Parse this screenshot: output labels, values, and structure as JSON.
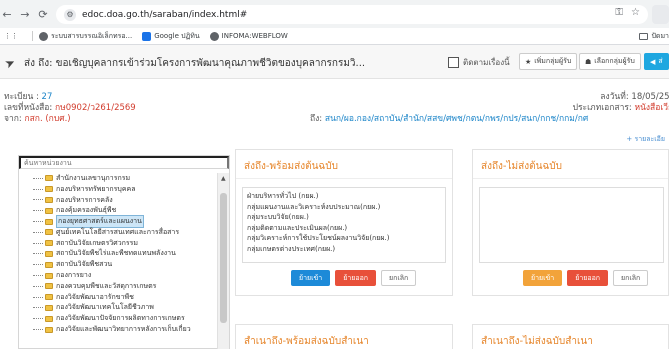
{
  "browser": {
    "url": "edoc.doa.go.th/saraban/index.html#",
    "bookmarks": [
      "ระบบสารบรรณอิเล็กทรอ...",
      "Google ปฏิทิน",
      "INFOMA:WEBFLOW"
    ],
    "bookmarks_right": "ปัดมา"
  },
  "header": {
    "title": "ส่ง ถึง: ขอเชิญบุคลากรเข้าร่วมโครงการพัฒนาคุณภาพชีวิตของบุคลากรกรมวิ...",
    "follow_label": "ติดตามเรื่องนี้",
    "add_group_label": "เพิ่มกลุ่มผู้รับ",
    "select_group_label": "เลือกกลุ่มผู้รับ",
    "send_label": "ส่"
  },
  "meta": {
    "reg_label": "ทะเบียน :",
    "reg_value": "27",
    "doc_no_label": "เลขที่หนังสือ",
    "doc_no_value": "กษ0902/ว261/2569",
    "from_label": "จาก:",
    "from_value": "กสก. (กบศ.)",
    "to_label": "ถึง:",
    "to_value": "สนก/ผอ.กอง/สถาบัน/สำนัก/สสข/ศพช/กตน/กพร/กปร/สนก/กกช/กกม/กศ",
    "date_label": "ลงวันที่:",
    "date_value": "18/05/256",
    "type_label": "ประเภทเอกสาร:",
    "type_value": "หนังสือเวีย",
    "more_link": "+ รายละเอีย"
  },
  "tree": {
    "search_placeholder": "ค้นหาหน่วยงาน",
    "items": [
      "สำนักงานเลขานุการกรม",
      "กองบริหารทรัพยากรบุคคล",
      "กองบริหารการคลัง",
      "กองคุ้มครองพันธุ์พืช",
      "กองยุทธศาสตร์และแผนงาน",
      "ศูนย์เทคโนโลยีสารสนเทศและการสื่อสาร",
      "สถาบันวิจัยเกษตรวิศวกรรม",
      "สถาบันวิจัยพืชไร่และพืชทดแทนพลังงาน",
      "สถาบันวิจัยพืชสวน",
      "กองการยาง",
      "กองควบคุมพืชและวัสดุการเกษตร",
      "กองวิจัยพัฒนาอารักขาพืช",
      "กองวิจัยพัฒนาเทคโนโลยีชีวภาพ",
      "กองวิจัยพัฒนาปัจจัยการผลิตทางการเกษตร",
      "กองวิจัยและพัฒนาวิทยาการหลังการเก็บเกี่ยว"
    ],
    "selected_index": 4
  },
  "cards": {
    "send_with_original": {
      "title": "ส่งถึง-พร้อมส่งต้นฉบับ",
      "rows": [
        "ฝ่ายบริหารทั่วไป (กยผ.)",
        "กลุ่มแผนงานและวิเคราะห์งบประมาณ(กยผ.)",
        "กลุ่มระบบวิจัย(กยผ.)",
        "กลุ่มติดตามและประเมินผล(กยผ.)",
        "กลุ่มวิเคราะห์การใช้ประโยชน์ผลงานวิจัย(กยผ.)",
        "กลุ่มเกษตรต่างประเทศ(กยผ.)"
      ],
      "btn_move_in": "ย้ายเข้า",
      "btn_move_out": "ย้ายออก",
      "btn_cancel": "ยกเลิก"
    },
    "send_without_original": {
      "title": "ส่งถึง-ไม่ส่งต้นฉบับ",
      "btn_move_in": "ย้ายเข้า",
      "btn_move_out": "ย้ายออก",
      "btn_cancel": "ยกเลิก"
    },
    "copy_with_copy": {
      "title": "สำเนาถึง-พร้อมส่งฉบับสำเนา"
    },
    "copy_without_copy": {
      "title": "สำเนาถึง-ไม่ส่งฉบับสำเนา"
    }
  },
  "colors": {
    "accent_blue": "#1d8ad8",
    "title_orange": "#e6852a",
    "red": "#e8503a",
    "orange_btn": "#f2a33a"
  }
}
